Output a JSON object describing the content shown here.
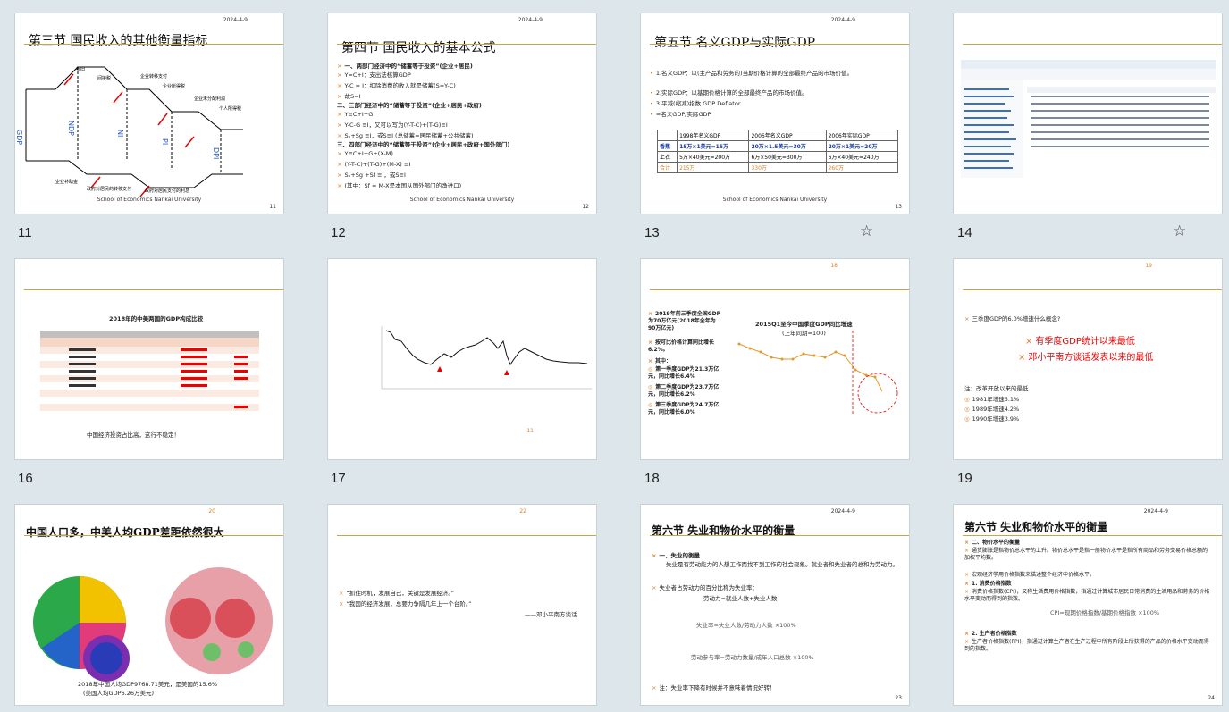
{
  "slides": [
    {
      "num": "11",
      "date": "",
      "title": "第三节  国民收入的其他衡量指标",
      "footer": "School of Economics Nankai University",
      "page": "11"
    },
    {
      "num": "12",
      "date": "2024-4-9",
      "title": "第四节  国民收入的基本公式",
      "footer": "School of Economics Nankai University",
      "page": "12",
      "lines": [
        "一、两部门经济中的“储蓄等于投资”(企业+居民)",
        "Y=C+I：支出法核算GDP",
        "Y-C = I：扣除消费的收入就是储蓄(S=Y-C)",
        "故S=I",
        "二、三部门经济中的“储蓄等于投资”(企业+居民+政府)",
        "Y≡C+I+G",
        "Y-C-G ≡I，又可以写为(Y-T-C)+(T-G)≡I",
        "Sₚ+Sg ≡I，或S≡I          (总储蓄=居民储蓄+公共储蓄)",
        "三、四部门经济中的“储蓄等于投资”(企业+居民+政府+国外部门)",
        "Y≡C+I+G+(X-M)",
        "(Y-T-C)+(T-G)+(M-X) ≡I",
        "Sₚ+Sg +Sf ≡I，或S≡I",
        "(其中：Sf = M-X是本国从国外部门的净进口)"
      ]
    },
    {
      "num": "13",
      "date": "2024-4-9",
      "title": "第五节  名义GDP与实际GDP",
      "footer": "School of Economics Nankai University",
      "page": "13",
      "lines": [
        "1.名义GDP：以(主产品和劳务的)当期价格计算的全部最终产品的市场价值。",
        "2.实际GDP：以基期价格计算的全部最终产品的市场价值。",
        "3.平减(缩减)指数 GDP Deflator",
        "=名义GDP/实际GDP"
      ],
      "table": {
        "header": [
          "",
          "1998年名义GDP",
          "2006年名义GDP",
          "2006年实际GDP"
        ],
        "rows": [
          [
            "香蕉",
            "15万×1美元=15万",
            "20万×1.5美元=30万",
            "20万×1美元=20万"
          ],
          [
            "上衣",
            "5万×40美元=200万",
            "6万×50美元=300万",
            "6万×40美元=240万"
          ],
          [
            "合计",
            "215万",
            "330万",
            "260万"
          ]
        ]
      }
    },
    {
      "num": "14",
      "date": "",
      "title": "",
      "footer": "",
      "page": ""
    },
    {
      "num": "16",
      "date": "",
      "title": "2018年的中美两国的GDP构成比较",
      "footer": "",
      "page": "",
      "caption": "中国经济投资占比高，这行不稳定！"
    },
    {
      "num": "17",
      "date": "",
      "title": "",
      "footer": "",
      "page": "11"
    },
    {
      "num": "18",
      "date": "",
      "title": "2015Q1至今中国季度GDP同比增速",
      "subtitle": "(上年同期=100)",
      "page": "18",
      "lines": [
        "2019年前三季度全国GDP为70万亿元(2018年全年为90万亿元)",
        "按可比价格计算同比增长6.2%。",
        "其中：",
        "第一季度GDP为21.3万亿元，同比增长6.4%",
        "第二季度GDP为23.7万亿元，同比增长6.2%",
        "第三季度GDP为24.7万亿元，同比增长6.0%"
      ]
    },
    {
      "num": "19",
      "date": "",
      "page": "19",
      "lines": [
        "三季度GDP的6.0%增速什么概念?",
        "有季度GDP统计以来最低",
        "邓小平南方谈话发表以来的最低",
        "注：改革开放以来的最低",
        "1981年增速5.1%",
        "1989年增速4.2%",
        "1990年增速3.9%"
      ]
    },
    {
      "num": "",
      "date": "",
      "title": "中国人口多，中美人均GDP差距依然很大",
      "page": "20",
      "caption": "2018年中国人均GDP9768.71美元，是美国的15.6%",
      "caption2": "(美国人均GDP6.26万美元)"
    },
    {
      "num": "",
      "page": "22",
      "lines": [
        "“抓住时机，发展自己，关键是发展经济。”",
        "“我国的经济发展，总要力争隔几年上一个台阶。”",
        "——邓小平南方谈话"
      ]
    },
    {
      "num": "",
      "date": "2024-4-9",
      "title": "第六节  失业和物价水平的衡量",
      "page": "23",
      "lines": [
        "一、失业的衡量",
        "失业是有劳动能力的人想工作而找不到工作的社会现象。就业者和失业者的总和为劳动力。",
        "失业者占劳动力的百分比称为失业率：",
        "劳动力=就业人数+失业人数",
        "失业率=失业人数/劳动力人数 ×100%",
        "劳动参与率=劳动力数量/成年人口总数 ×100%",
        "注：失业率下降有时候并不意味着情况好转！"
      ]
    },
    {
      "num": "",
      "date": "2024-4-9",
      "title": "第六节  失业和物价水平的衡量",
      "page": "24",
      "lines": [
        "二、物价水平的衡量",
        "通货膨胀是指物价总水平的上升。物价总水平是指一般物价水平是指所有商品和劳务交易价格总额的加权平均数。",
        "宏观经济学用价格指数来描述整个经济中价格水平。",
        "1. 消费价格指数",
        "消费价格指数(CPI)，又称生活费用价格指数，指通过计算城市居民日常消费的生活用品和劳务的价格水平变动而得到的指数。",
        "CPI=现期价格指数/基期价格指数 ×100%",
        "2. 生产者价格指数",
        "生产者价格指数(PPI)，指通过计算生产者在生产过程中所有阶段上所获得的产品的价格水平变动而得到的指数。"
      ]
    }
  ],
  "slide_numbers": [
    "11",
    "12",
    "13",
    "14",
    "16",
    "17",
    "18",
    "19"
  ]
}
